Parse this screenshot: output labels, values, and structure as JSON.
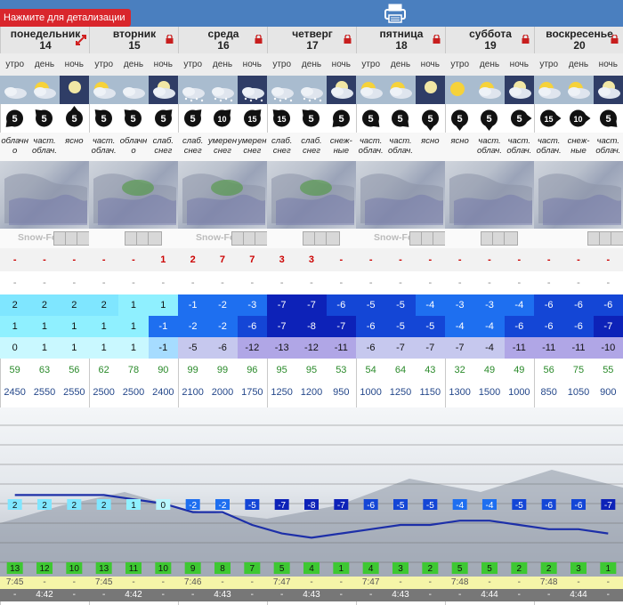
{
  "toolbar": {
    "detail_label": "Нажмите для детализации"
  },
  "colors": {
    "topbar": "#4a7fbf",
    "detail_button": "#d9262c",
    "snow_value": "#cc0000"
  },
  "days": [
    {
      "name": "понедельник",
      "date": "14",
      "icon": "expand-icon"
    },
    {
      "name": "вторник",
      "date": "15",
      "icon": "lock-icon"
    },
    {
      "name": "среда",
      "date": "16",
      "icon": "lock-icon"
    },
    {
      "name": "четверг",
      "date": "17",
      "icon": "lock-icon"
    },
    {
      "name": "пятница",
      "date": "18",
      "icon": "lock-icon"
    },
    {
      "name": "суббота",
      "date": "19",
      "icon": "lock-icon"
    },
    {
      "name": "воскресенье",
      "date": "20",
      "icon": "lock-icon"
    }
  ],
  "time_of_day": [
    "утро",
    "день",
    "ночь"
  ],
  "weather_icons": [
    "cloud-icon",
    "sun-cloud-icon",
    "moon-icon",
    "sun-cloud-icon",
    "cloud-icon",
    "cloud-night-icon",
    "snow-cloud-icon",
    "snow-cloud-icon",
    "snow-cloud-icon",
    "snow-cloud-icon",
    "snow-cloud-icon",
    "moon-cloud-icon",
    "sun-cloud-icon",
    "sun-cloud-icon",
    "moon-icon",
    "sun-icon",
    "sun-cloud-icon",
    "moon-cloud-icon",
    "sun-cloud-icon",
    "sun-cloud-icon",
    "moon-cloud-icon"
  ],
  "wind": [
    {
      "v": "5",
      "dir": 225
    },
    {
      "v": "5",
      "dir": 315
    },
    {
      "v": "5",
      "dir": 0
    },
    {
      "v": "5",
      "dir": 315
    },
    {
      "v": "5",
      "dir": 315
    },
    {
      "v": "5",
      "dir": 45
    },
    {
      "v": "5",
      "dir": 45
    },
    {
      "v": "10",
      "dir": 45
    },
    {
      "v": "15",
      "dir": 45
    },
    {
      "v": "15",
      "dir": 315
    },
    {
      "v": "5",
      "dir": 315
    },
    {
      "v": "5",
      "dir": 225
    },
    {
      "v": "5",
      "dir": 135
    },
    {
      "v": "5",
      "dir": 135
    },
    {
      "v": "5",
      "dir": 180
    },
    {
      "v": "5",
      "dir": 180
    },
    {
      "v": "5",
      "dir": 180
    },
    {
      "v": "5",
      "dir": 90
    },
    {
      "v": "15",
      "dir": 90
    },
    {
      "v": "10",
      "dir": 90
    },
    {
      "v": "5",
      "dir": 135
    }
  ],
  "summaries": [
    "облачн о",
    "част. облач.",
    "ясно",
    "част. облач.",
    "облачн о",
    "слаб. снег",
    "слаб. снег",
    "умерен снег",
    "умерен снег",
    "слаб. снег",
    "слаб. снег",
    "снеж- ные",
    "част. облач.",
    "част. облач.",
    "ясно",
    "ясно",
    "част. облач.",
    "част. облач.",
    "част. облач.",
    "снеж- ные",
    "част. облач."
  ],
  "map_watermark": [
    "Snow-Forecast.com",
    "Snow-Forecast.com",
    "Snow-Forecast.com"
  ],
  "snow": [
    "-",
    "-",
    "-",
    "-",
    "-",
    "1",
    "2",
    "7",
    "7",
    "3",
    "3",
    "-",
    "-",
    "-",
    "-",
    "-",
    "-",
    "-",
    "-",
    "-",
    "-"
  ],
  "rain": [
    "-",
    "-",
    "-",
    "-",
    "-",
    "-",
    "-",
    "-",
    "-",
    "-",
    "-",
    "-",
    "-",
    "-",
    "-",
    "-",
    "-",
    "-",
    "-",
    "-",
    "-"
  ],
  "temp_max": [
    2,
    2,
    2,
    2,
    1,
    1,
    -1,
    -2,
    -3,
    -7,
    -7,
    -6,
    -5,
    -5,
    -4,
    -3,
    -3,
    -4,
    -6,
    -6,
    -6
  ],
  "temp_min": [
    1,
    1,
    1,
    1,
    1,
    -1,
    -2,
    -2,
    -6,
    -7,
    -8,
    -7,
    -6,
    -5,
    -5,
    -4,
    -4,
    -6,
    -6,
    -6,
    -7
  ],
  "temp_feels": [
    0,
    1,
    1,
    1,
    1,
    -1,
    -5,
    -6,
    -12,
    -13,
    -12,
    -11,
    -6,
    -7,
    -7,
    -7,
    -4,
    -11,
    -11,
    -11,
    -10
  ],
  "humidity": [
    59,
    63,
    56,
    62,
    78,
    90,
    99,
    99,
    96,
    95,
    95,
    53,
    54,
    64,
    43,
    32,
    49,
    49,
    56,
    75,
    55
  ],
  "freezing_level": [
    2450,
    2550,
    2550,
    2500,
    2500,
    2400,
    2100,
    2000,
    1750,
    1250,
    1200,
    950,
    1000,
    1250,
    1150,
    1300,
    1500,
    1000,
    850,
    1050,
    900
  ],
  "chart_data": {
    "type": "line",
    "series": [
      {
        "values": [
          2,
          2,
          2,
          2,
          1,
          0,
          -2,
          -2,
          -5,
          -7,
          -8,
          -7,
          -6,
          -5,
          -5,
          -4,
          -4,
          -5,
          -6,
          -6,
          -7
        ]
      }
    ],
    "low_labels": [
      13,
      12,
      10,
      13,
      11,
      10,
      9,
      8,
      7,
      5,
      4,
      1,
      4,
      3,
      2,
      5,
      5,
      2,
      2,
      3,
      1
    ]
  },
  "sunrise": [
    "7:45",
    "-",
    "-",
    "7:45",
    "-",
    "-",
    "7:46",
    "-",
    "-",
    "7:47",
    "-",
    "-",
    "7:47",
    "-",
    "-",
    "7:48",
    "-",
    "-",
    "7:48",
    "-",
    "-"
  ],
  "sunset": [
    "-",
    "4:42",
    "-",
    "-",
    "4:42",
    "-",
    "-",
    "4:43",
    "-",
    "-",
    "4:43",
    "-",
    "-",
    "4:43",
    "-",
    "-",
    "4:44",
    "-",
    "-",
    "4:44",
    "-"
  ]
}
